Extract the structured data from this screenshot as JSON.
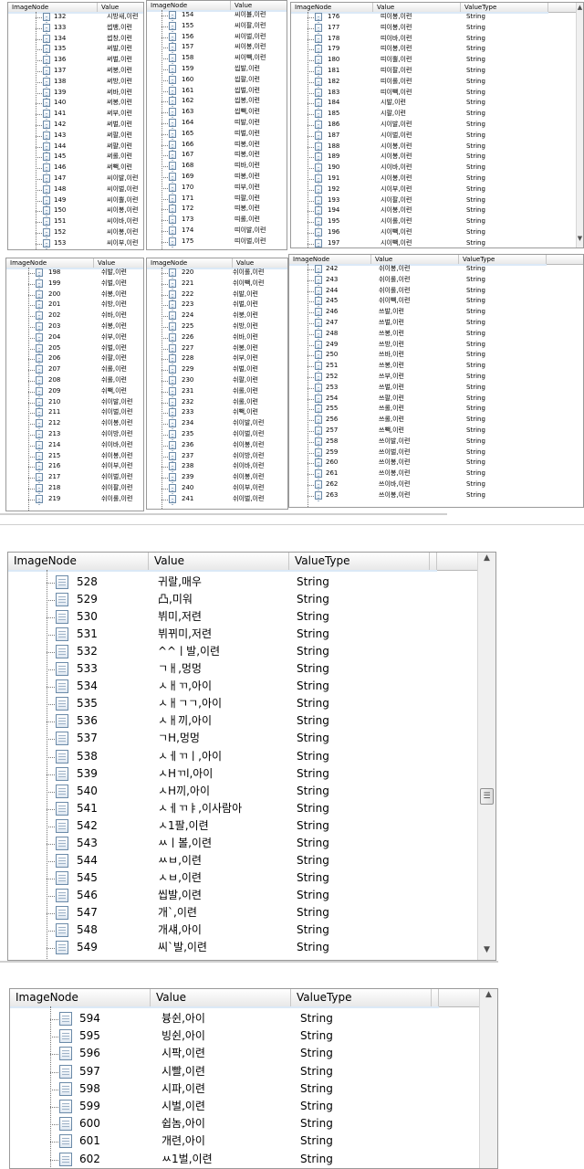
{
  "headers": {
    "node": "ImageNode",
    "value": "Value",
    "type": "ValueType"
  },
  "top_grid": {
    "panel_a1": {
      "rows": [
        [
          "132",
          "시방새,이련"
        ],
        [
          "133",
          "썹뱅,이련"
        ],
        [
          "134",
          "썹창,이련"
        ],
        [
          "135",
          "써발,이련"
        ],
        [
          "136",
          "써벌,이련"
        ],
        [
          "137",
          "써붕,이련"
        ],
        [
          "138",
          "써방,이련"
        ],
        [
          "139",
          "써바,이련"
        ],
        [
          "140",
          "써봉,이련"
        ],
        [
          "141",
          "써부,이련"
        ],
        [
          "142",
          "써벌,이련"
        ],
        [
          "143",
          "써팔,이련"
        ],
        [
          "144",
          "써퍌,이련"
        ],
        [
          "145",
          "써롤,이련"
        ],
        [
          "146",
          "써빽,이련"
        ],
        [
          "147",
          "씨이발,이련"
        ],
        [
          "148",
          "씨이벌,이련"
        ],
        [
          "149",
          "씨이뿔,이련"
        ],
        [
          "150",
          "씨이봉,이련"
        ],
        [
          "151",
          "씨이바,이련"
        ],
        [
          "152",
          "씨이봉,이련"
        ],
        [
          "153",
          "씨이부,이련"
        ]
      ]
    },
    "panel_a2": {
      "rows": [
        [
          "154",
          "씨이뷸,이련"
        ],
        [
          "155",
          "씨이팔,이련"
        ],
        [
          "156",
          "씨이벌,이련"
        ],
        [
          "157",
          "씨이봉,이련"
        ],
        [
          "158",
          "씨이빽,이련"
        ],
        [
          "159",
          "씹발,이련"
        ],
        [
          "160",
          "씹팔,이련"
        ],
        [
          "161",
          "씹벌,이련"
        ],
        [
          "162",
          "씹봉,이련"
        ],
        [
          "163",
          "씹빽,이련"
        ],
        [
          "164",
          "띠발,이련"
        ],
        [
          "165",
          "띠벌,이련"
        ],
        [
          "166",
          "띠봉,이련"
        ],
        [
          "167",
          "띠봉,이련"
        ],
        [
          "168",
          "띠바,이련"
        ],
        [
          "169",
          "띠봉,이련"
        ],
        [
          "170",
          "띠부,이련"
        ],
        [
          "171",
          "띠팔,이련"
        ],
        [
          "172",
          "띠봉,이련"
        ],
        [
          "173",
          "띠롤,이련"
        ],
        [
          "174",
          "띠이발,이련"
        ],
        [
          "175",
          "띠이벌,이련"
        ]
      ]
    },
    "panel_a3": {
      "type": "String",
      "rows": [
        [
          "176",
          "띠이봉,이련"
        ],
        [
          "177",
          "띠이봉,이련"
        ],
        [
          "178",
          "띠이바,이련"
        ],
        [
          "179",
          "띠이봉,이련"
        ],
        [
          "180",
          "띠이뿔,이련"
        ],
        [
          "181",
          "띠이팔,이련"
        ],
        [
          "182",
          "띠이롤,이련"
        ],
        [
          "183",
          "띠이빽,이련"
        ],
        [
          "184",
          "시발,이련"
        ],
        [
          "185",
          "시팔,이련"
        ],
        [
          "186",
          "시이발,이련"
        ],
        [
          "187",
          "시이벌,이련"
        ],
        [
          "188",
          "시이봉,이련"
        ],
        [
          "189",
          "시이봉,이련"
        ],
        [
          "190",
          "시이바,이련"
        ],
        [
          "191",
          "시이봉,이련"
        ],
        [
          "192",
          "시이부,이련"
        ],
        [
          "193",
          "시이팔,이련"
        ],
        [
          "194",
          "시이봉,이련"
        ],
        [
          "195",
          "시이롤,이련"
        ],
        [
          "196",
          "시이빽,이련"
        ],
        [
          "197",
          "시이빽,이련"
        ]
      ]
    },
    "panel_b1": {
      "rows": [
        [
          "198",
          "쉬발,이련"
        ],
        [
          "199",
          "쉬벌,이련"
        ],
        [
          "200",
          "쉬봉,이련"
        ],
        [
          "201",
          "쉬방,이련"
        ],
        [
          "202",
          "쉬바,이련"
        ],
        [
          "203",
          "쉬봉,이련"
        ],
        [
          "204",
          "쉬부,이련"
        ],
        [
          "205",
          "쉬벌,이련"
        ],
        [
          "206",
          "쉬팔,이련"
        ],
        [
          "207",
          "쉬롤,이련"
        ],
        [
          "208",
          "쉬롤,이련"
        ],
        [
          "209",
          "쉬빽,이련"
        ],
        [
          "210",
          "쉬이발,이련"
        ],
        [
          "211",
          "쉬이벌,이련"
        ],
        [
          "212",
          "쉬이봉,이련"
        ],
        [
          "213",
          "쉬이방,이련"
        ],
        [
          "214",
          "쉬이바,이련"
        ],
        [
          "215",
          "쉬이봉,이련"
        ],
        [
          "216",
          "쉬이부,이련"
        ],
        [
          "217",
          "쉬이벌,이련"
        ],
        [
          "218",
          "쉬이팔,이련"
        ],
        [
          "219",
          "쉬이롤,이련"
        ]
      ]
    },
    "panel_b2": {
      "rows": [
        [
          "220",
          "쉬이롤,이련"
        ],
        [
          "221",
          "쉬이빽,이련"
        ],
        [
          "222",
          "쉬발,이련"
        ],
        [
          "223",
          "쉬벌,이련"
        ],
        [
          "224",
          "쉬붕,이련"
        ],
        [
          "225",
          "쉬방,이련"
        ],
        [
          "226",
          "쉬바,이련"
        ],
        [
          "227",
          "쉬봉,이련"
        ],
        [
          "228",
          "쉬부,이련"
        ],
        [
          "229",
          "쉬벌,이련"
        ],
        [
          "230",
          "쉬팔,이련"
        ],
        [
          "231",
          "쉬롤,이련"
        ],
        [
          "232",
          "쉬롤,이련"
        ],
        [
          "233",
          "쉬빽,이련"
        ],
        [
          "234",
          "쉬이발,이련"
        ],
        [
          "235",
          "쉬이벌,이련"
        ],
        [
          "236",
          "쉬이봉,이련"
        ],
        [
          "237",
          "쉬이방,이련"
        ],
        [
          "238",
          "쉬이바,이련"
        ],
        [
          "239",
          "쉬이봉,이련"
        ],
        [
          "240",
          "쉬이부,이련"
        ],
        [
          "241",
          "쉬이벌,이련"
        ]
      ]
    },
    "panel_b3": {
      "type": "String",
      "rows": [
        [
          "242",
          "쉬이봉,이련"
        ],
        [
          "243",
          "쉬이롤,이련"
        ],
        [
          "244",
          "쉬이롤,이련"
        ],
        [
          "245",
          "쉬이빽,이련"
        ],
        [
          "246",
          "쓰발,이련"
        ],
        [
          "247",
          "쓰벌,이련"
        ],
        [
          "248",
          "쓰봉,이련"
        ],
        [
          "249",
          "쓰방,이련"
        ],
        [
          "250",
          "쓰바,이련"
        ],
        [
          "251",
          "쓰봉,이련"
        ],
        [
          "252",
          "쓰부,이련"
        ],
        [
          "253",
          "쓰벌,이련"
        ],
        [
          "254",
          "쓰팔,이련"
        ],
        [
          "255",
          "쓰롤,이련"
        ],
        [
          "256",
          "쓰롤,이련"
        ],
        [
          "257",
          "쓰빽,이련"
        ],
        [
          "258",
          "쓰이발,이련"
        ],
        [
          "259",
          "쓰이벌,이련"
        ],
        [
          "260",
          "쓰이봉,이련"
        ],
        [
          "261",
          "쓰이봉,이련"
        ],
        [
          "262",
          "쓰이바,이련"
        ],
        [
          "263",
          "쓰이봉,이련"
        ]
      ]
    }
  },
  "middle_panel": {
    "type": "String",
    "rows": [
      [
        "528",
        "귀랄,매우"
      ],
      [
        "529",
        "凸,미워"
      ],
      [
        "530",
        "뷔미,저련"
      ],
      [
        "531",
        "뷔뀌미,저련"
      ],
      [
        "532",
        "^^ㅣ발,이련"
      ],
      [
        "533",
        "ㄱㅐ,멍멍"
      ],
      [
        "534",
        "ㅅㅐㄲ,아이"
      ],
      [
        "535",
        "ㅅㅐㄱㄱ,아이"
      ],
      [
        "536",
        "ㅅㅐ끼,아이"
      ],
      [
        "537",
        "ㄱH,멍멍"
      ],
      [
        "538",
        "ㅅㅔㄲㅣ,아이"
      ],
      [
        "539",
        "ㅅHㄲl,아이"
      ],
      [
        "540",
        "ㅅH끼,아이"
      ],
      [
        "541",
        "ㅅㅔㄲㅑ,이사람아"
      ],
      [
        "542",
        "ㅅ1팔,이련"
      ],
      [
        "543",
        "ㅆㅣ볼,이련"
      ],
      [
        "544",
        "ㅆㅂ,이련"
      ],
      [
        "545",
        "ㅅㅂ,이련"
      ],
      [
        "546",
        "씹발,이련"
      ],
      [
        "547",
        "개`,이련"
      ],
      [
        "548",
        "개섀,아이"
      ],
      [
        "549",
        "씨`발,이련"
      ]
    ]
  },
  "bottom_panel": {
    "type": "String",
    "rows": [
      [
        "594",
        "븅쉰,아이"
      ],
      [
        "595",
        "빙쉰,아이"
      ],
      [
        "596",
        "시팍,이련"
      ],
      [
        "597",
        "시빨,이련"
      ],
      [
        "598",
        "시파,이련"
      ],
      [
        "599",
        "시벌,이련"
      ],
      [
        "600",
        "쉽놈,아이"
      ],
      [
        "601",
        "개련,아이"
      ],
      [
        "602",
        "ㅆ1벌,이련"
      ]
    ]
  },
  "icons": {
    "scroll_up": "▲",
    "scroll_down": "▼",
    "thumb_grip": "☰"
  }
}
